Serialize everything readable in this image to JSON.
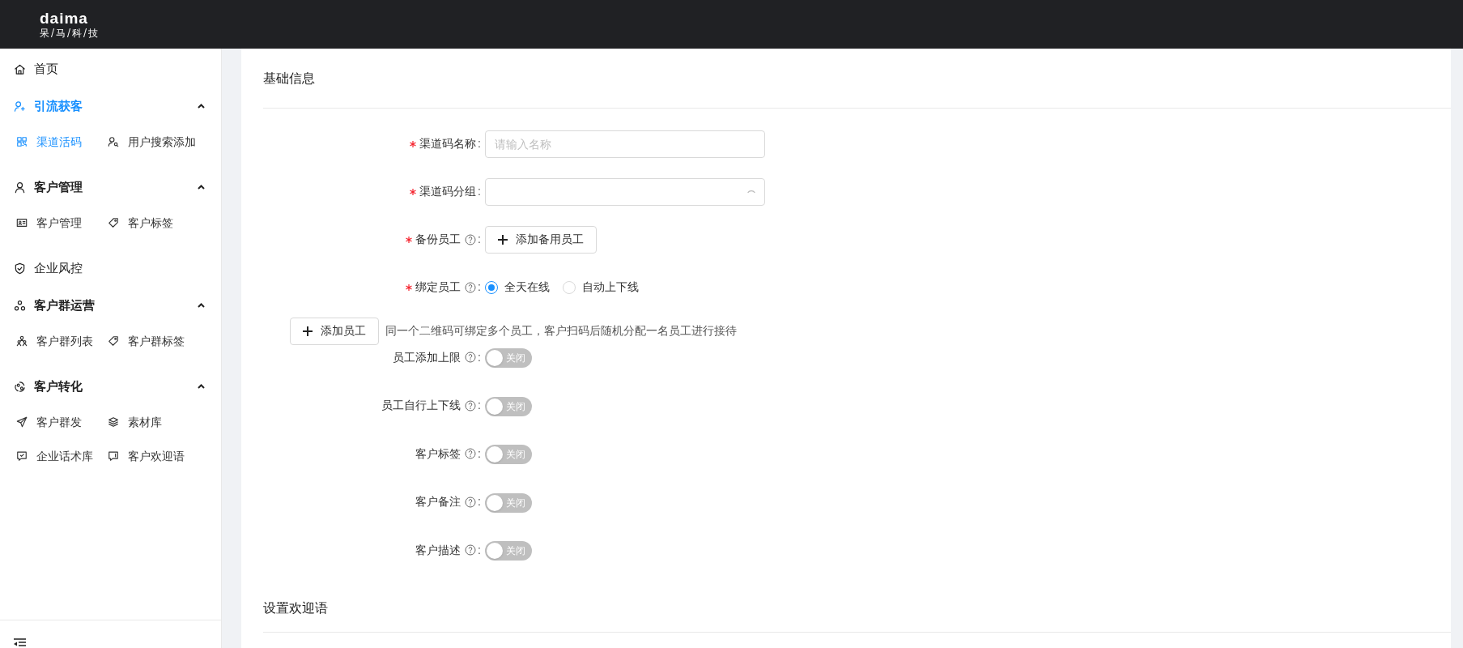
{
  "header": {
    "logo": "daima",
    "tagline": "呆/马/科/技"
  },
  "sidebar": {
    "items": [
      {
        "kind": "link",
        "label": "首页",
        "selected": false
      },
      {
        "kind": "group",
        "label": "引流获客",
        "selected": true,
        "expanded": true,
        "children": [
          {
            "label": "渠道活码",
            "selected": true
          },
          {
            "label": "用户搜索添加",
            "selected": false
          }
        ]
      },
      {
        "kind": "group",
        "label": "客户管理",
        "selected": false,
        "expanded": true,
        "children": [
          {
            "label": "客户管理",
            "selected": false
          },
          {
            "label": "客户标签",
            "selected": false
          }
        ]
      },
      {
        "kind": "link",
        "label": "企业风控",
        "selected": false
      },
      {
        "kind": "group",
        "label": "客户群运营",
        "selected": false,
        "expanded": true,
        "children": [
          {
            "label": "客户群列表",
            "selected": false
          },
          {
            "label": "客户群标签",
            "selected": false
          }
        ]
      },
      {
        "kind": "group",
        "label": "客户转化",
        "selected": false,
        "expanded": true,
        "children": [
          {
            "label": "客户群发",
            "selected": false
          },
          {
            "label": "素材库",
            "selected": false
          },
          {
            "label": "企业话术库",
            "selected": false
          },
          {
            "label": "客户欢迎语",
            "selected": false
          }
        ]
      }
    ]
  },
  "form": {
    "title": "基础信息",
    "fields": [
      {
        "kind": "input",
        "label": "渠道码名称",
        "colon": ":",
        "required": true,
        "help": false,
        "placeholder": "请输入名称"
      },
      {
        "kind": "select",
        "label": "渠道码分组",
        "colon": ":",
        "required": true,
        "help": false
      },
      {
        "kind": "button",
        "label": "备份员工",
        "colon": ":",
        "required": true,
        "help": true,
        "button": "添加备用员工"
      },
      {
        "kind": "radio",
        "label": "绑定员工",
        "colon": ":",
        "required": true,
        "help": true,
        "options": [
          {
            "label": "全天在线",
            "selected": true
          },
          {
            "label": "自动上下线",
            "selected": false
          }
        ]
      },
      {
        "kind": "action",
        "button": "添加员工",
        "hint": "同一个二维码可绑定多个员工，客户扫码后随机分配一名员工进行接待"
      },
      {
        "kind": "switch",
        "label": "员工添加上限",
        "colon": ":",
        "required": false,
        "help": true,
        "on": false,
        "text": "关闭"
      },
      {
        "kind": "switch",
        "label": "员工自行上下线",
        "colon": ":",
        "required": false,
        "help": true,
        "on": false,
        "text": "关闭"
      },
      {
        "kind": "switch",
        "label": "客户标签",
        "colon": ":",
        "required": false,
        "help": true,
        "on": false,
        "text": "关闭"
      },
      {
        "kind": "switch",
        "label": "客户备注",
        "colon": ":",
        "required": false,
        "help": true,
        "on": false,
        "text": "关闭"
      },
      {
        "kind": "switch",
        "label": "客户描述",
        "colon": ":",
        "required": false,
        "help": true,
        "on": false,
        "text": "关闭"
      }
    ],
    "next_section": "设置欢迎语"
  }
}
